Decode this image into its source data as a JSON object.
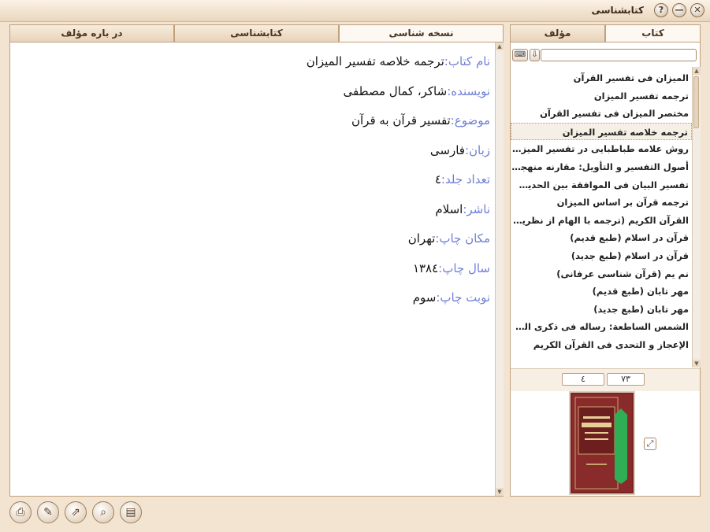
{
  "window": {
    "title": "کتابشناسی",
    "controls": {
      "close": "✕",
      "minimize": "—",
      "help": "?"
    }
  },
  "left_tabs": [
    "در باره مؤلف",
    "کتابشناسی",
    "نسخه شناسی"
  ],
  "right_tabs": [
    "مؤلف",
    "کتاب"
  ],
  "details": [
    {
      "label": "نام کتاب:",
      "value": "ترجمه خلاصه تفسیر المیزان"
    },
    {
      "label": "نویسنده:",
      "value": "شاکر، کمال مصطفی"
    },
    {
      "label": "موضوع:",
      "value": "تفسیر قرآن به قرآن"
    },
    {
      "label": "زبان:",
      "value": "فارسی"
    },
    {
      "label": "تعداد جلد:",
      "value": "٤"
    },
    {
      "label": "ناشر:",
      "value": "اسلام"
    },
    {
      "label": "مکان چاپ:",
      "value": "تهران"
    },
    {
      "label": "سال چاپ:",
      "value": "١٣٨٤"
    },
    {
      "label": "نوبت چاپ:",
      "value": "سوم"
    }
  ],
  "search": {
    "value": ""
  },
  "book_list": [
    "المیزان فی تفسیر القرآن",
    "ترجمه تفسیر المیزان",
    "مختصر المیزان فی تفسیر القرآن",
    "ترجمه خلاصه تفسیر المیزان",
    "روش علامه طباطبایی در تفسیر المیزان",
    "أصول التفسیر و التأویل: مقارنه منهجیة بی ...",
    "تفسیر البیان فی الموافقة بین الحدیث و الق ...",
    "ترجمه قرآن بر اساس المیزان",
    "القرآن الکریم (ترجمه با الهام از نظریات ع ...",
    "قرآن در اسلام (طبع قدیم)",
    "قرآن در اسلام (طبع جدید)",
    "نم یم (قرآن شناسی عرفانی)",
    "مهر تابان (طبع قدیم)",
    "مهر تابان (طبع جدید)",
    "الشمس الساطعة: رساله فی ذکری العالم الر ...",
    "الإعجاز و التحدی فی القرآن الکریم"
  ],
  "selected_index": 3,
  "pager": {
    "total": "٧٣",
    "current": "٤"
  },
  "cover": {
    "title": "ترجمه خلاصه تفسیر المیزان"
  }
}
